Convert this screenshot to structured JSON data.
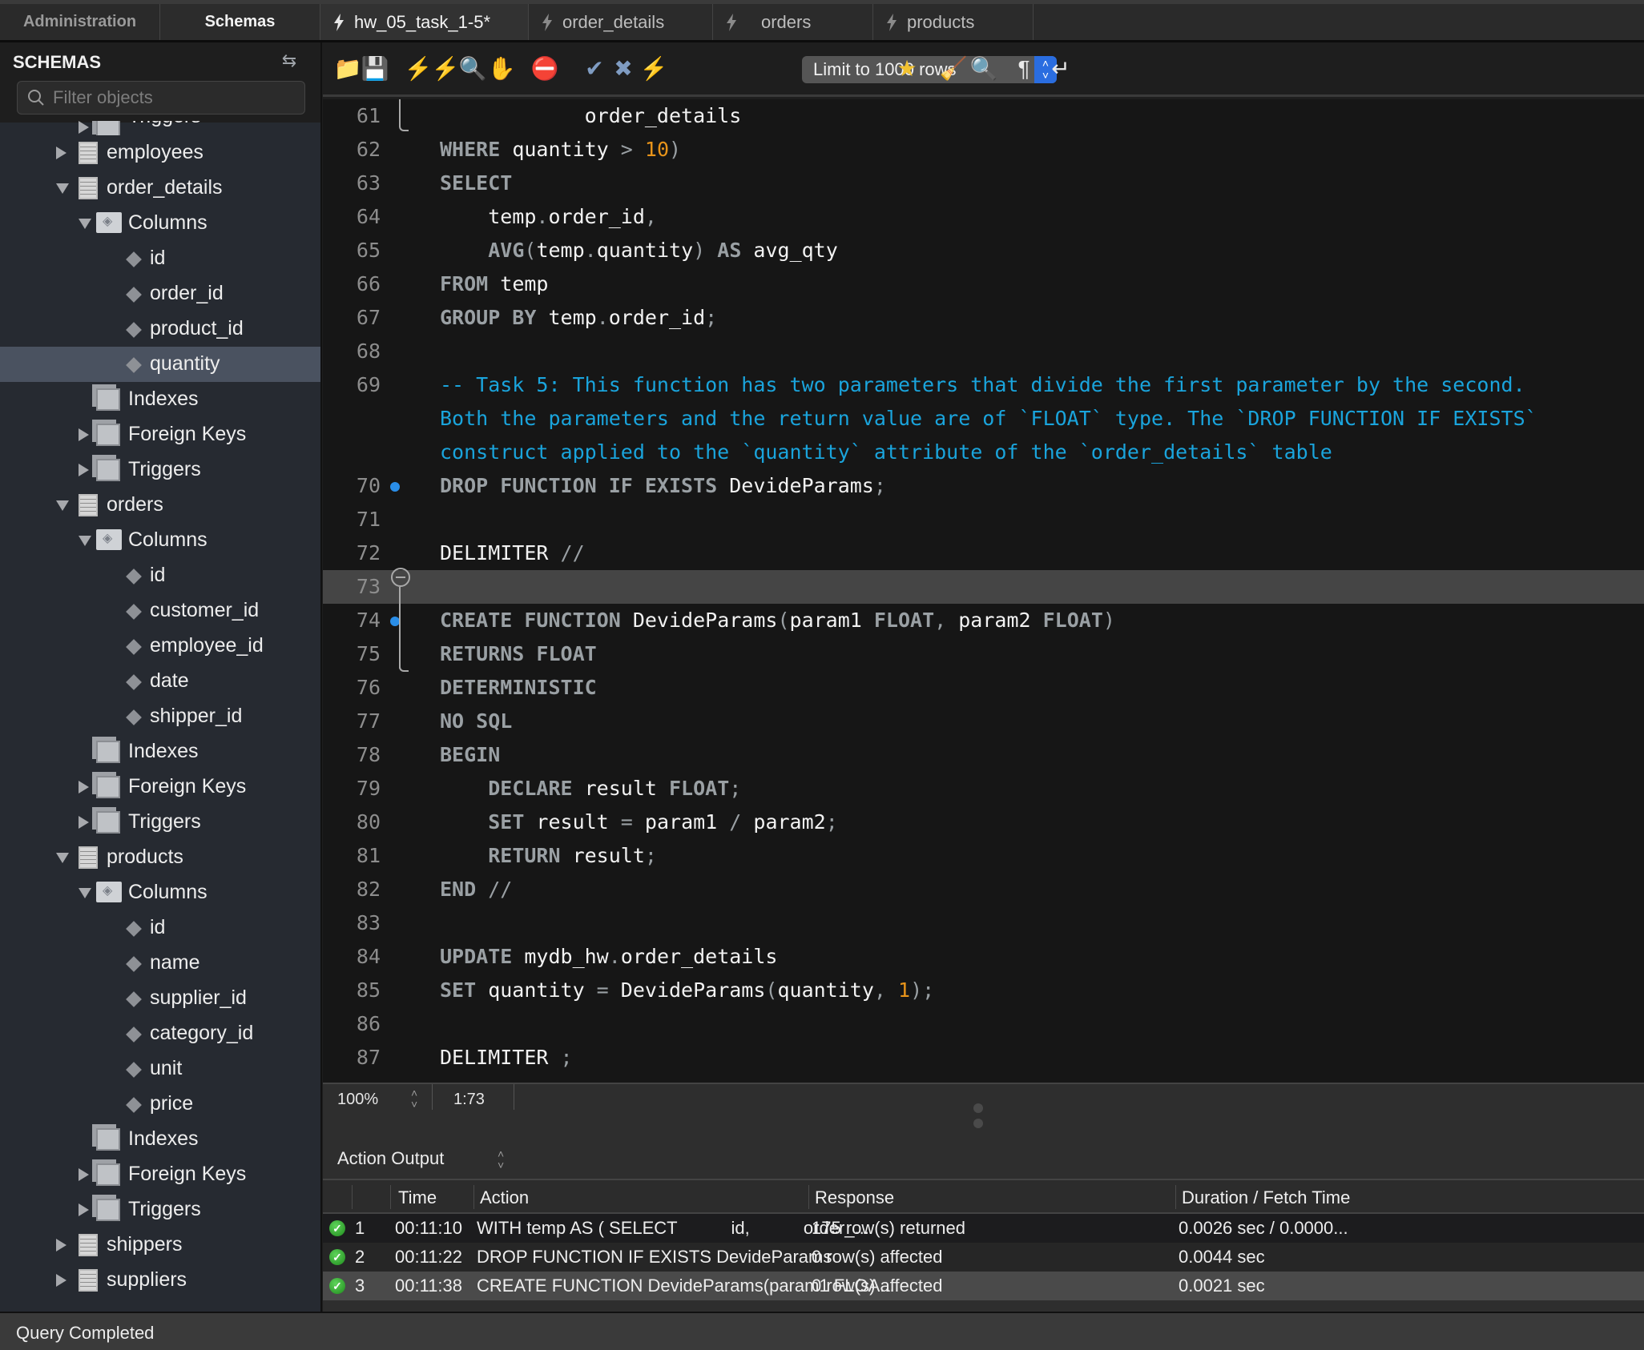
{
  "top_tabs": {
    "sidebar_tabs": [
      {
        "label": "Administration",
        "active": false
      },
      {
        "label": "Schemas",
        "active": true
      }
    ],
    "document_tabs": [
      {
        "label": "hw_05_task_1-5*",
        "icon": "lightning-icon",
        "active": true
      },
      {
        "label": "order_details",
        "icon": "lightning-icon",
        "active": false
      },
      {
        "label": "orders",
        "icon": "lightning-icon",
        "active": false
      },
      {
        "label": "products",
        "icon": "lightning-icon",
        "active": false
      }
    ]
  },
  "sidebar": {
    "title": "SCHEMAS",
    "refresh_icon": "refresh-icon",
    "filter_placeholder": "Filter objects",
    "tree": [
      {
        "label": "Triggers",
        "type": "group",
        "level": 2,
        "expander": "right",
        "partial": true
      },
      {
        "label": "employees",
        "type": "table",
        "level": 1,
        "expander": "right"
      },
      {
        "label": "order_details",
        "type": "table",
        "level": 1,
        "expander": "down"
      },
      {
        "label": "Columns",
        "type": "folder",
        "level": 2,
        "expander": "down"
      },
      {
        "label": "id",
        "type": "column",
        "level": 3
      },
      {
        "label": "order_id",
        "type": "column",
        "level": 3
      },
      {
        "label": "product_id",
        "type": "column",
        "level": 3
      },
      {
        "label": "quantity",
        "type": "column",
        "level": 3,
        "selected": true
      },
      {
        "label": "Indexes",
        "type": "group",
        "level": 2
      },
      {
        "label": "Foreign Keys",
        "type": "group",
        "level": 2,
        "expander": "right"
      },
      {
        "label": "Triggers",
        "type": "group",
        "level": 2,
        "expander": "right"
      },
      {
        "label": "orders",
        "type": "table",
        "level": 1,
        "expander": "down"
      },
      {
        "label": "Columns",
        "type": "folder",
        "level": 2,
        "expander": "down"
      },
      {
        "label": "id",
        "type": "column",
        "level": 3
      },
      {
        "label": "customer_id",
        "type": "column",
        "level": 3
      },
      {
        "label": "employee_id",
        "type": "column",
        "level": 3
      },
      {
        "label": "date",
        "type": "column",
        "level": 3
      },
      {
        "label": "shipper_id",
        "type": "column",
        "level": 3
      },
      {
        "label": "Indexes",
        "type": "group",
        "level": 2
      },
      {
        "label": "Foreign Keys",
        "type": "group",
        "level": 2,
        "expander": "right"
      },
      {
        "label": "Triggers",
        "type": "group",
        "level": 2,
        "expander": "right"
      },
      {
        "label": "products",
        "type": "table",
        "level": 1,
        "expander": "down"
      },
      {
        "label": "Columns",
        "type": "folder",
        "level": 2,
        "expander": "down"
      },
      {
        "label": "id",
        "type": "column",
        "level": 3
      },
      {
        "label": "name",
        "type": "column",
        "level": 3
      },
      {
        "label": "supplier_id",
        "type": "column",
        "level": 3
      },
      {
        "label": "category_id",
        "type": "column",
        "level": 3
      },
      {
        "label": "unit",
        "type": "column",
        "level": 3
      },
      {
        "label": "price",
        "type": "column",
        "level": 3
      },
      {
        "label": "Indexes",
        "type": "group",
        "level": 2
      },
      {
        "label": "Foreign Keys",
        "type": "group",
        "level": 2,
        "expander": "right"
      },
      {
        "label": "Triggers",
        "type": "group",
        "level": 2,
        "expander": "right"
      },
      {
        "label": "shippers",
        "type": "table",
        "level": 1,
        "expander": "right"
      },
      {
        "label": "suppliers",
        "type": "table",
        "level": 1,
        "expander": "right"
      }
    ]
  },
  "toolbar": {
    "buttons": [
      {
        "name": "open-file-button",
        "icon": "folder-icon",
        "glyph": "📁"
      },
      {
        "name": "save-button",
        "icon": "save-icon",
        "glyph": "💾"
      },
      {
        "name": "execute-all-button",
        "icon": "lightning-icon",
        "glyph": "⚡"
      },
      {
        "name": "execute-current-button",
        "icon": "lightning-cursor-icon",
        "glyph": "⚡"
      },
      {
        "name": "explain-button",
        "icon": "magnifier-lightning-icon",
        "glyph": "🔍"
      },
      {
        "name": "stop-button",
        "icon": "stop-hand-icon",
        "glyph": "✋"
      },
      {
        "name": "stop-on-error-button",
        "icon": "error-stop-icon",
        "glyph": "⛔"
      },
      {
        "name": "commit-button",
        "icon": "check-circle-icon",
        "glyph": "✔"
      },
      {
        "name": "rollback-button",
        "icon": "x-circle-icon",
        "glyph": "✖"
      },
      {
        "name": "autocommit-button",
        "icon": "autocommit-icon",
        "glyph": "⚡"
      },
      {
        "name": "add-snippet-button",
        "icon": "star-plus-icon",
        "glyph": "★"
      },
      {
        "name": "beautify-button",
        "icon": "broom-icon",
        "glyph": "🧹"
      },
      {
        "name": "find-button",
        "icon": "search-icon",
        "glyph": "🔍"
      },
      {
        "name": "invisible-chars-button",
        "icon": "pilcrow-icon",
        "glyph": "¶"
      },
      {
        "name": "word-wrap-button",
        "icon": "wrap-icon",
        "glyph": "↵"
      }
    ],
    "limit_select": "Limit to 1000 rows"
  },
  "editor": {
    "current_line": 73,
    "lines": [
      {
        "n": "61",
        "tokens": [
          {
            "t": "            order_details",
            "c": ""
          }
        ]
      },
      {
        "n": "62",
        "tokens": [
          {
            "t": "WHERE",
            "c": "kw"
          },
          {
            "t": " quantity ",
            "c": ""
          },
          {
            "t": ">",
            "c": "op"
          },
          {
            "t": " ",
            "c": ""
          },
          {
            "t": "10",
            "c": "num"
          },
          {
            "t": ")",
            "c": "op"
          }
        ]
      },
      {
        "n": "63",
        "tokens": [
          {
            "t": "SELECT",
            "c": "kw"
          }
        ]
      },
      {
        "n": "64",
        "tokens": [
          {
            "t": "    temp",
            "c": ""
          },
          {
            "t": ".",
            "c": "op"
          },
          {
            "t": "order_id",
            "c": ""
          },
          {
            "t": ",",
            "c": "op"
          }
        ]
      },
      {
        "n": "65",
        "tokens": [
          {
            "t": "    ",
            "c": ""
          },
          {
            "t": "AVG",
            "c": "kw"
          },
          {
            "t": "(",
            "c": "op"
          },
          {
            "t": "temp",
            "c": ""
          },
          {
            "t": ".",
            "c": "op"
          },
          {
            "t": "quantity",
            "c": ""
          },
          {
            "t": ")",
            "c": "op"
          },
          {
            "t": " ",
            "c": ""
          },
          {
            "t": "AS",
            "c": "kw"
          },
          {
            "t": " avg_qty",
            "c": ""
          }
        ]
      },
      {
        "n": "66",
        "tokens": [
          {
            "t": "FROM",
            "c": "kw"
          },
          {
            "t": " temp",
            "c": ""
          }
        ]
      },
      {
        "n": "67",
        "tokens": [
          {
            "t": "GROUP BY",
            "c": "kw"
          },
          {
            "t": " temp",
            "c": ""
          },
          {
            "t": ".",
            "c": "op"
          },
          {
            "t": "order_id",
            "c": ""
          },
          {
            "t": ";",
            "c": "op"
          }
        ]
      },
      {
        "n": "68",
        "tokens": []
      },
      {
        "n": "69",
        "comment": [
          "-- Task 5: This function has two parameters that divide the first parameter by the second.",
          "Both the parameters and the return value are of `FLOAT` type. The `DROP FUNCTION IF EXISTS`",
          "construct applied to the `quantity` attribute of the `order_details` table"
        ]
      },
      {
        "n": "70",
        "marker": true,
        "tokens": [
          {
            "t": "DROP FUNCTION IF EXISTS",
            "c": "kw"
          },
          {
            "t": " DevideParams",
            "c": ""
          },
          {
            "t": ";",
            "c": "op"
          }
        ]
      },
      {
        "n": "71",
        "tokens": []
      },
      {
        "n": "72",
        "tokens": [
          {
            "t": "DELIMITER ",
            "c": ""
          },
          {
            "t": "//",
            "c": "op"
          }
        ]
      },
      {
        "n": "73",
        "tokens": []
      },
      {
        "n": "74",
        "marker": true,
        "tokens": [
          {
            "t": "CREATE FUNCTION",
            "c": "kw"
          },
          {
            "t": " DevideParams",
            "c": ""
          },
          {
            "t": "(",
            "c": "op"
          },
          {
            "t": "param1 ",
            "c": ""
          },
          {
            "t": "FLOAT",
            "c": "kw"
          },
          {
            "t": ",",
            "c": "op"
          },
          {
            "t": " param2 ",
            "c": ""
          },
          {
            "t": "FLOAT",
            "c": "kw"
          },
          {
            "t": ")",
            "c": "op"
          }
        ]
      },
      {
        "n": "75",
        "tokens": [
          {
            "t": "RETURNS FLOAT",
            "c": "kw"
          }
        ]
      },
      {
        "n": "76",
        "tokens": [
          {
            "t": "DETERMINISTIC",
            "c": "kw"
          }
        ]
      },
      {
        "n": "77",
        "tokens": [
          {
            "t": "NO SQL",
            "c": "kw"
          }
        ]
      },
      {
        "n": "78",
        "tokens": [
          {
            "t": "BEGIN",
            "c": "kw"
          }
        ]
      },
      {
        "n": "79",
        "tokens": [
          {
            "t": "    ",
            "c": ""
          },
          {
            "t": "DECLARE",
            "c": "kw"
          },
          {
            "t": " result ",
            "c": ""
          },
          {
            "t": "FLOAT",
            "c": "kw"
          },
          {
            "t": ";",
            "c": "op"
          }
        ]
      },
      {
        "n": "80",
        "tokens": [
          {
            "t": "    ",
            "c": ""
          },
          {
            "t": "SET",
            "c": "kw"
          },
          {
            "t": " result ",
            "c": ""
          },
          {
            "t": "=",
            "c": "op"
          },
          {
            "t": " param1 ",
            "c": ""
          },
          {
            "t": "/",
            "c": "op"
          },
          {
            "t": " param2",
            "c": ""
          },
          {
            "t": ";",
            "c": "op"
          }
        ]
      },
      {
        "n": "81",
        "tokens": [
          {
            "t": "    ",
            "c": ""
          },
          {
            "t": "RETURN",
            "c": "kw"
          },
          {
            "t": " result",
            "c": ""
          },
          {
            "t": ";",
            "c": "op"
          }
        ]
      },
      {
        "n": "82",
        "tokens": [
          {
            "t": "END",
            "c": "kw"
          },
          {
            "t": " ",
            "c": ""
          },
          {
            "t": "//",
            "c": "op"
          }
        ]
      },
      {
        "n": "83",
        "tokens": []
      },
      {
        "n": "84",
        "tokens": [
          {
            "t": "UPDATE",
            "c": "kw"
          },
          {
            "t": " mydb_hw",
            "c": ""
          },
          {
            "t": ".",
            "c": "op"
          },
          {
            "t": "order_details",
            "c": ""
          }
        ]
      },
      {
        "n": "85",
        "tokens": [
          {
            "t": "SET",
            "c": "kw"
          },
          {
            "t": " quantity ",
            "c": ""
          },
          {
            "t": "=",
            "c": "op"
          },
          {
            "t": " DevideParams",
            "c": ""
          },
          {
            "t": "(",
            "c": "op"
          },
          {
            "t": "quantity",
            "c": ""
          },
          {
            "t": ",",
            "c": "op"
          },
          {
            "t": " ",
            "c": ""
          },
          {
            "t": "1",
            "c": "num"
          },
          {
            "t": ");",
            "c": "op"
          }
        ]
      },
      {
        "n": "86",
        "tokens": []
      },
      {
        "n": "87",
        "tokens": [
          {
            "t": "DELIMITER ",
            "c": ""
          },
          {
            "t": ";",
            "c": "op"
          }
        ]
      }
    ]
  },
  "status_strip": {
    "zoom": "100%",
    "cursor_position": "1:73"
  },
  "output": {
    "title": "Action Output",
    "columns": [
      "",
      "",
      "Time",
      "Action",
      "Response",
      "Duration / Fetch Time"
    ],
    "rows": [
      {
        "status": "success",
        "index": "1",
        "time": "00:11:10",
        "action": "WITH temp AS ( SELECT           id,           order_...",
        "response": "175 row(s) returned",
        "duration": "0.0026 sec / 0.0000..."
      },
      {
        "status": "success",
        "index": "2",
        "time": "00:11:22",
        "action": "DROP FUNCTION IF EXISTS DevideParams",
        "response": "0 row(s) affected",
        "duration": "0.0044 sec"
      },
      {
        "status": "success",
        "index": "3",
        "time": "00:11:38",
        "action": "CREATE FUNCTION DevideParams(param1 FLOA...",
        "response": "0 row(s) affected",
        "duration": "0.0021 sec"
      }
    ]
  },
  "app_status": "Query Completed"
}
